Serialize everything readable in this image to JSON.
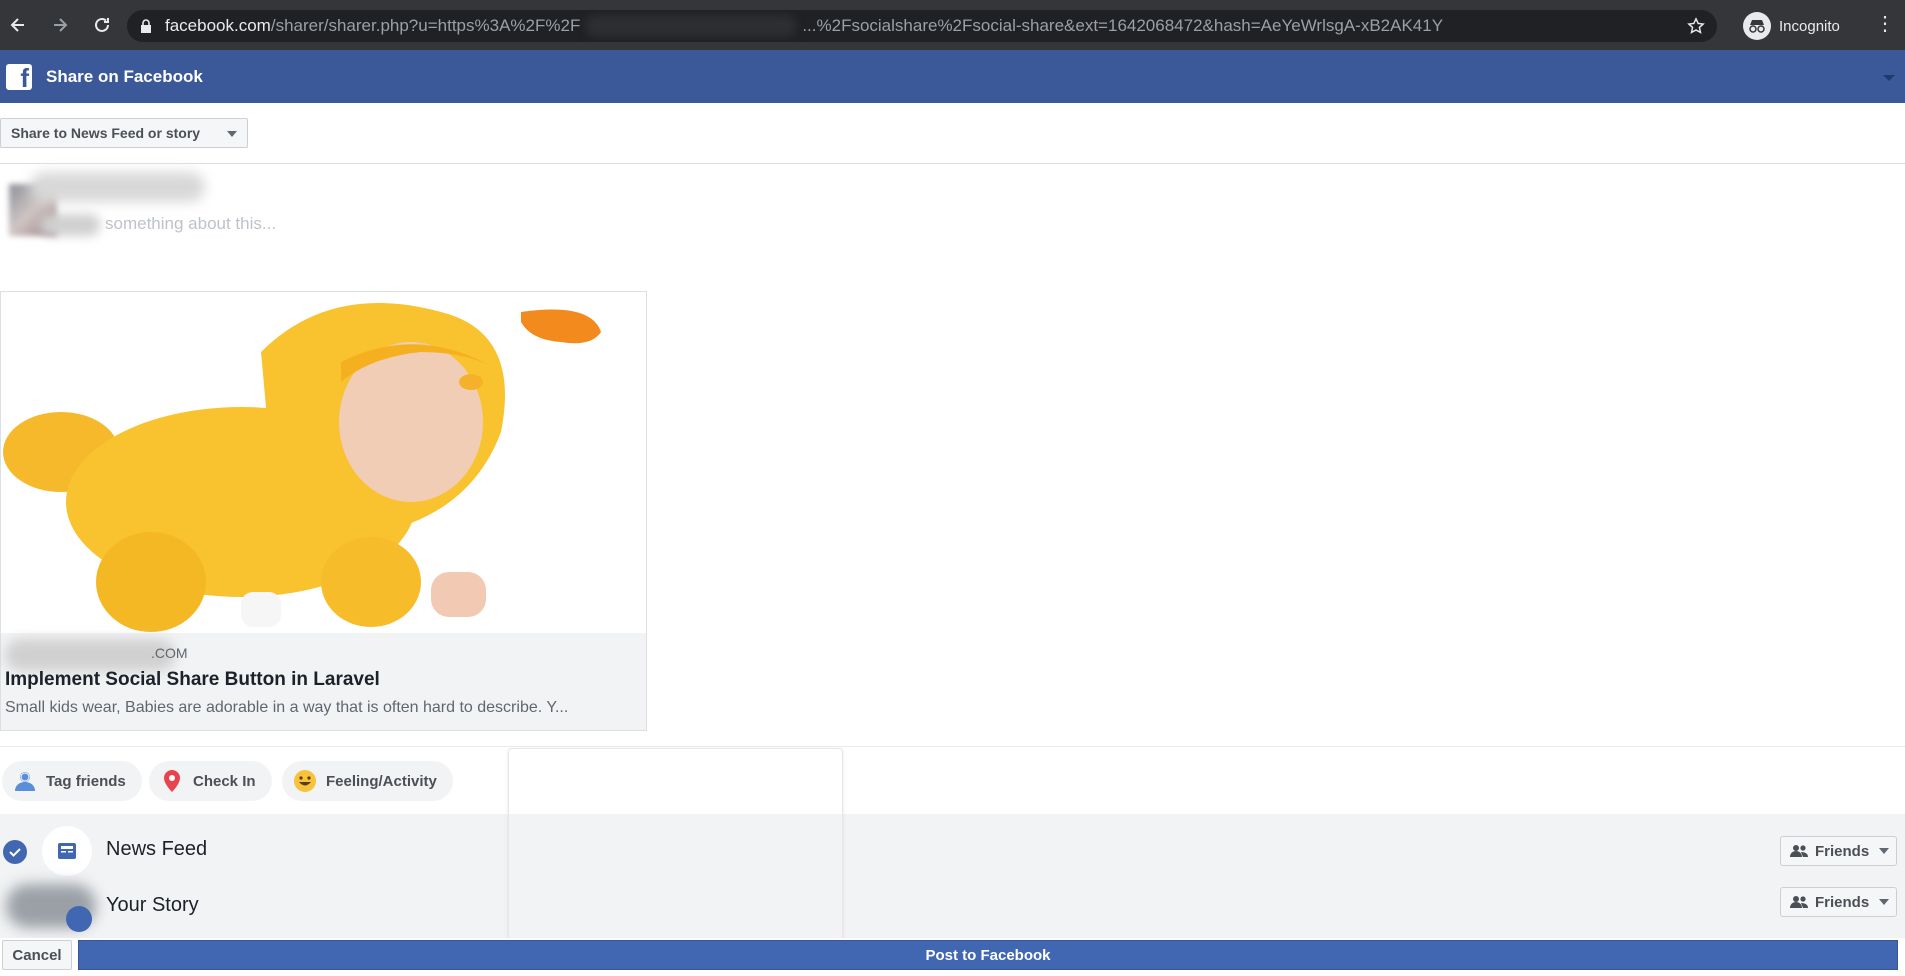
{
  "browser": {
    "url_host": "facebook.com",
    "url_path_start": "/sharer/sharer.php?u=https%3A%2F%2F",
    "url_path_end": "...%2Fsocialshare%2Fsocial-share&ext=1642068472&hash=AeYeWrlsgA-xB2AK41Y",
    "incognito_label": "Incognito",
    "icons": [
      "back-icon",
      "forward-icon",
      "reload-icon",
      "lock-icon",
      "star-icon",
      "incognito-icon",
      "kebab-menu-icon"
    ]
  },
  "header": {
    "title": "Share on Facebook",
    "brand_color": "#3b5998"
  },
  "share_target": {
    "selected": "Share to News Feed or story"
  },
  "composer": {
    "placeholder": "something about this..."
  },
  "link_card": {
    "domain": ".COM",
    "title": "Implement Social Share Button in Laravel",
    "description": "Small kids wear, Babies are adorable in a way that is often hard to describe. Y..."
  },
  "actions": [
    {
      "label": "Tag friends",
      "icon": "tag-friends-icon"
    },
    {
      "label": "Check In",
      "icon": "location-pin-icon"
    },
    {
      "label": "Feeling/Activity",
      "icon": "smiley-icon"
    }
  ],
  "audience": {
    "news_feed": {
      "label": "News Feed",
      "privacy": "Friends",
      "checked": true
    },
    "your_story": {
      "label": "Your Story",
      "privacy": "Friends"
    }
  },
  "footer": {
    "cancel_label": "Cancel",
    "post_label": "Post to Facebook",
    "post_color": "#4267b2"
  }
}
